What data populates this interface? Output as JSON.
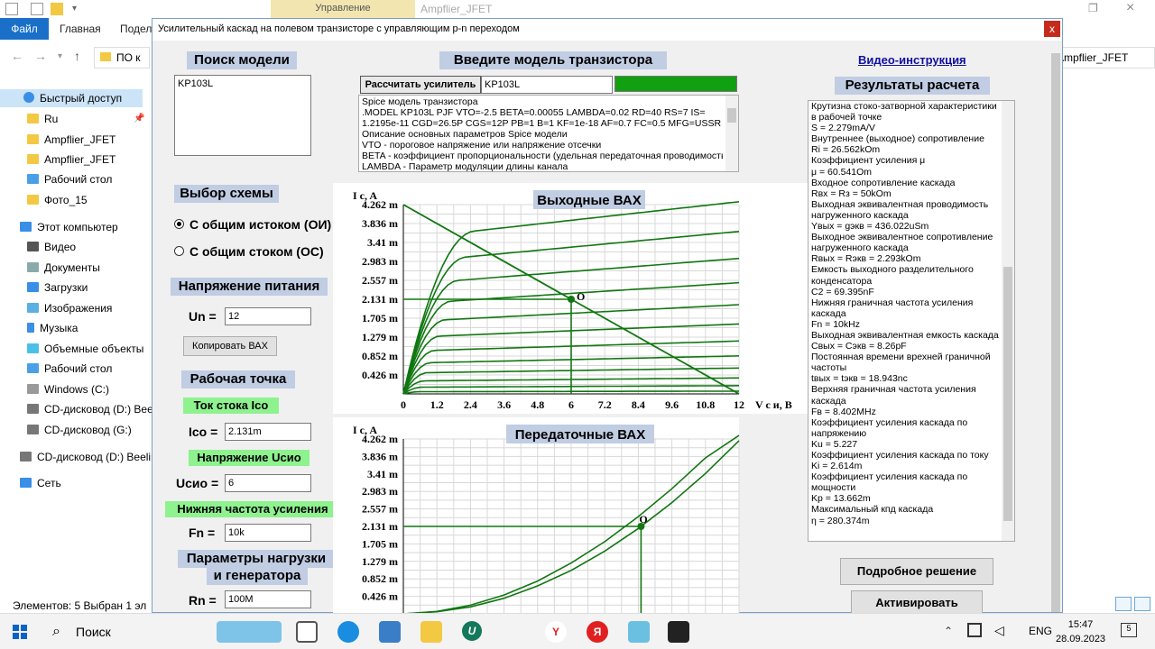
{
  "explorer": {
    "manage_tab": "Управление",
    "window_title": "Ampflier_JFET",
    "ribbon_tabs": [
      "Файл",
      "Главная",
      "Подел"
    ],
    "address_fragment": "ПО к",
    "address_right": "Ampflier_JFET",
    "nav": {
      "quick_access": "Быстрый доступ",
      "items": [
        "Ru",
        "Ampflier_JFET",
        "Ampflier_JFET",
        "Рабочий стол",
        "Фото_15"
      ],
      "this_pc": "Этот компьютер",
      "pc_items": [
        "Видео",
        "Документы",
        "Загрузки",
        "Изображения",
        "Музыка",
        "Объемные объекты",
        "Рабочий стол",
        "Windows (C:)",
        "CD-дисковод (D:) Beel",
        "CD-дисковод (G:)"
      ],
      "cd_drive": "CD-дисковод (D:) Beelir",
      "network": "Сеть"
    },
    "status": "Элементов: 5    Выбран 1 эл"
  },
  "app": {
    "title": "Усилительный каскад на полевом транзисторе с управляющим p-n переходом",
    "close": "x",
    "search_label": "Поиск модели",
    "search_value": "KP103L",
    "scheme_label": "Выбор схемы",
    "radio_oi": "С общим истоком (ОИ)",
    "radio_os": "С общим стоком (ОС)",
    "radio_selected": "oi",
    "supply_label": "Напряжение питания",
    "un_label": "Un =",
    "un_value": "12",
    "copy_button": "Копировать ВАХ",
    "work_point_label": "Рабочая точка",
    "ico_label": "Ток стока Ico",
    "ico_field_label": "Ico =",
    "ico_value": "2.131m",
    "ucio_label": "Напряжение Uсио",
    "ucio_field_label": "Uсио =",
    "ucio_value": "6",
    "fn_label": "Нижняя частота усиления",
    "fn_field_label": "Fn =",
    "fn_value": "10k",
    "load_label_1": "Параметры нагрузки",
    "load_label_2": "и генератора",
    "rn_field_label": "Rn =",
    "rn_value": "100M",
    "model_label": "Введите модель транзистора",
    "calc_button": "Рассчитать усилитель",
    "model_value": "KP103L",
    "status_color": "#10a010",
    "spice_lines": [
      "Spice модель транзистора",
      ".MODEL KP103L PJF VTO=-2.5 BETA=0.00055 LAMBDA=0.02 RD=40 RS=7 IS=",
      "1.2195e-11 CGD=26.5P CGS=12P PB=1 B=1 KF=1e-18 AF=0.7 FC=0.5 MFG=USSR",
      "Описание основных параметров Spice модели",
      "VTO - пороговое напряжение или напряжение отсечки",
      "BETA - коэффициент пропорциональности (удельная передаточная проводимость)",
      "LAMBDA - Параметр модуляции длины канала"
    ],
    "video_link": "Видео-инструкция",
    "results_label": "Результаты расчета",
    "results_lines": [
      "Крутизна стоко-затворной характеристики",
      "в рабочей точке",
      "S = 2.279mA/V",
      "Внутреннее (выходное) сопротивление",
      "Ri = 26.562kOm",
      "Коэффициент усиления μ",
      "μ = 60.541Om",
      "Входное сопротивление каскада",
      "Rвх = Rз = 50kOm",
      "Выходная эквивалентная проводимость",
      "нагруженного каскада",
      "Yвых = gэкв = 436.022uSm",
      "Выходное эквивалентное сопротивление",
      "нагруженного каскада",
      "Rвых = Rэкв = 2.293kOm",
      "Емкость выходного разделительного",
      "конденсатора",
      "C2 = 69.395nF",
      "Нижняя граничная частота усиления",
      "каскада",
      "Fn = 10kHz",
      "Выходная эквивалентная емкость каскада",
      "Cвых = Cэкв = 8.26pF",
      "Постоянная времени врехней граничной",
      "частоты",
      "tвых = tэкв = 18.943nc",
      "Верхняя граничная частота усиления",
      "каскада",
      "Fв = 8.402MHz",
      "Коэффициент усиления каскада по",
      "напряжению",
      "Ku = 5.227",
      "Коэффициент усиления каскада по току",
      "Ki = 2.614m",
      "Коэффициент усиления каскада по",
      "мощности",
      "Kp = 13.662m",
      "Максимальный кпд каскада",
      "η = 280.374m"
    ],
    "detail_button": "Подробное решение",
    "activate_button": "Активировать"
  },
  "chart_data": [
    {
      "type": "line",
      "title": "Выходные ВАХ",
      "ylabel": "I c, A",
      "xlabel": "V c и, B",
      "x_ticks": [
        "0",
        "1.2",
        "2.4",
        "3.6",
        "4.8",
        "6",
        "7.2",
        "8.4",
        "9.6",
        "10.8",
        "12"
      ],
      "y_ticks": [
        "4.262 m",
        "3.836 m",
        "3.41 m",
        "2.983 m",
        "2.557 m",
        "2.131 m",
        "1.705 m",
        "1.279 m",
        "0.852 m",
        "0.426 m"
      ],
      "xlim": [
        0,
        12
      ],
      "ylim": [
        0,
        4.262
      ],
      "y_unit": "mA",
      "grid": true,
      "saturation_currents": [
        3.49,
        2.95,
        2.46,
        2.02,
        1.62,
        1.27,
        0.96,
        0.69,
        0.47,
        0.29,
        0.15,
        0.05
      ],
      "lambda": 0.02,
      "load_line": {
        "x": [
          0,
          12
        ],
        "y": [
          4.262,
          0
        ]
      },
      "operating_point": {
        "x": 6,
        "y": 2.131,
        "label": "O"
      },
      "line_color": "#117711"
    },
    {
      "type": "line",
      "title": "Передаточные ВАХ",
      "ylabel": "I c, A",
      "y_ticks": [
        "4.262 m",
        "3.836 m",
        "3.41 m",
        "2.983 m",
        "2.557 m",
        "2.131 m",
        "1.705 m",
        "1.279 m",
        "0.852 m",
        "0.426 m"
      ],
      "ylim": [
        0,
        4.262
      ],
      "y_unit": "mA",
      "grid": true,
      "curves": [
        {
          "x": [
            0,
            0.1,
            0.2,
            0.3,
            0.4,
            0.5,
            0.6,
            0.7,
            0.8,
            0.9,
            1.0
          ],
          "y": [
            0,
            0.06,
            0.21,
            0.46,
            0.8,
            1.24,
            1.76,
            2.37,
            3.05,
            3.8,
            4.6
          ]
        },
        {
          "x": [
            0,
            0.1,
            0.2,
            0.3,
            0.4,
            0.5,
            0.6,
            0.7,
            0.8,
            0.9,
            1.0
          ],
          "y": [
            0,
            0.05,
            0.17,
            0.38,
            0.68,
            1.06,
            1.53,
            2.08,
            2.71,
            3.42,
            4.22
          ]
        }
      ],
      "operating_point": {
        "y": 2.131,
        "label": "O"
      },
      "line_color": "#117711"
    }
  ],
  "taskbar": {
    "search": "Поиск",
    "lang": "ENG",
    "time": "15:47",
    "date": "28.09.2023",
    "notif": "5"
  }
}
